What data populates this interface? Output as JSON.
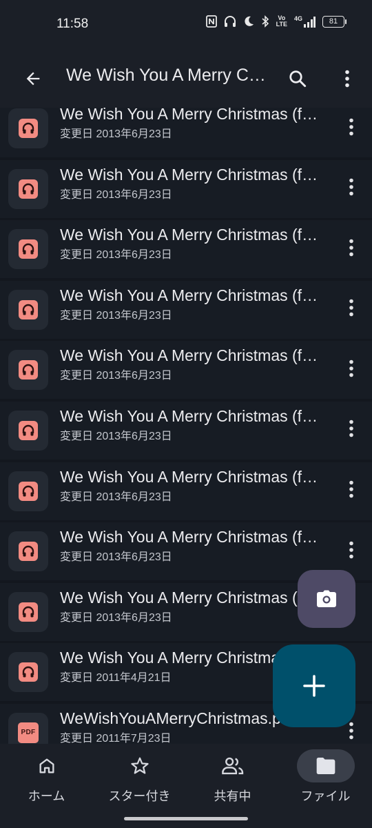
{
  "status_bar": {
    "time": "11:58",
    "network_top": "Vo",
    "network_bottom": "LTE",
    "signal_label": "4G",
    "battery": "81",
    "icons": [
      "nfc-icon",
      "headphones-icon",
      "moon-icon",
      "bluetooth-icon",
      "volte-icon",
      "signal-icon",
      "battery-icon"
    ]
  },
  "app_bar": {
    "title": "We Wish You A Merry Christmas",
    "icons": [
      "back-arrow-icon",
      "search-icon",
      "more-vert-icon"
    ]
  },
  "files": [
    {
      "name": "We Wish You A Merry Christmas (feat. A Cappella Kid...",
      "meta": "変更日 2013年6月23日",
      "type": "audio"
    },
    {
      "name": "We Wish You A Merry Christmas (feat. A Cappella Kid...",
      "meta": "変更日 2013年6月23日",
      "type": "audio"
    },
    {
      "name": "We Wish You A Merry Christmas (feat. A Cappella Kid...",
      "meta": "変更日 2013年6月23日",
      "type": "audio"
    },
    {
      "name": "We Wish You A Merry Christmas (feat. A Cappella Kid...",
      "meta": "変更日 2013年6月23日",
      "type": "audio"
    },
    {
      "name": "We Wish You A Merry Christmas (feat. A Cappella Kid...",
      "meta": "変更日 2013年6月23日",
      "type": "audio"
    },
    {
      "name": "We Wish You A Merry Christmas (feat. A Cappella Kid...",
      "meta": "変更日 2013年6月23日",
      "type": "audio"
    },
    {
      "name": "We Wish You A Merry Christmas (feat. A Cappella Kid...",
      "meta": "変更日 2013年6月23日",
      "type": "audio"
    },
    {
      "name": "We Wish You A Merry Christmas (feat. A Cappella Kid...",
      "meta": "変更日 2013年6月23日",
      "type": "audio"
    },
    {
      "name": "We Wish You A Merry Christmas (feat. A Cappella Kid...",
      "meta": "変更日 2013年6月23日",
      "type": "audio"
    },
    {
      "name": "We Wish You A Merry Christmas (feat. A Cappella Kid...",
      "meta": "変更日 2011年4月21日",
      "type": "audio"
    },
    {
      "name": "WeWishYouAMerryChristmas.pdf",
      "meta": "変更日 2011年7月23日",
      "type": "pdf",
      "badge": "PDF"
    }
  ],
  "fabs": {
    "camera_icon": "camera-icon",
    "new_icon": "plus-icon",
    "new_color": "#00506b",
    "camera_color": "#4e4a66"
  },
  "bottom_nav": {
    "items": [
      {
        "label": "ホーム",
        "icon": "home-icon"
      },
      {
        "label": "スター付き",
        "icon": "star-icon"
      },
      {
        "label": "共有中",
        "icon": "people-icon"
      },
      {
        "label": "ファイル",
        "icon": "folder-icon",
        "active": true
      }
    ]
  },
  "colors": {
    "background": "#13171e",
    "row": "#171c24",
    "audio_badge": "#f28b82"
  }
}
